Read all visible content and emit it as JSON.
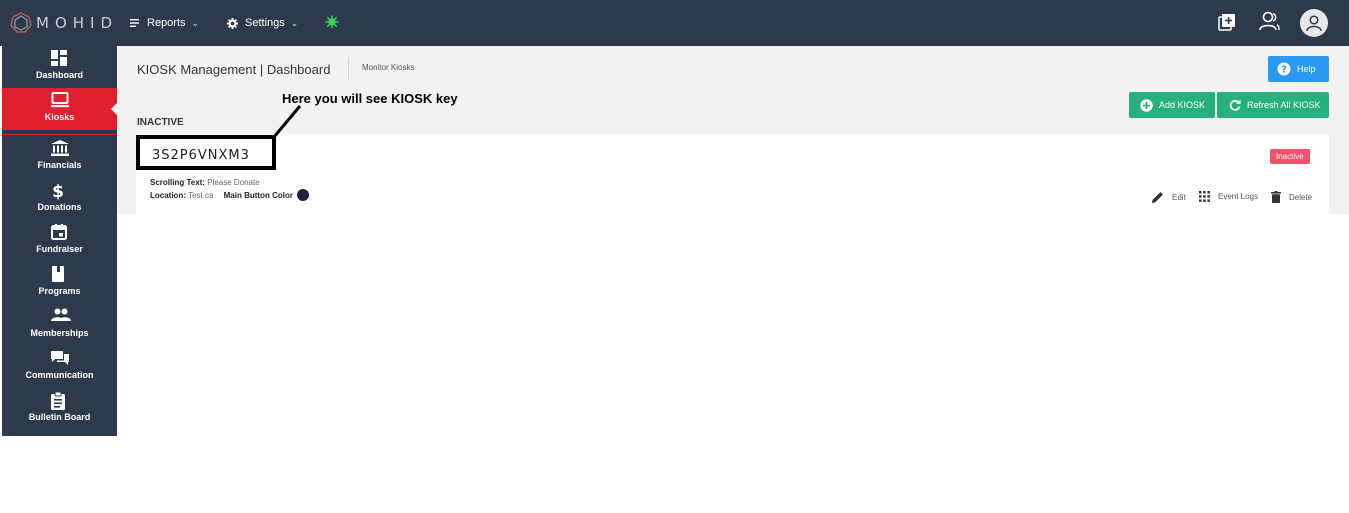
{
  "header": {
    "logo_text": "MOHID",
    "nav": [
      {
        "label": "Reports"
      },
      {
        "label": "Settings"
      }
    ],
    "colors": {
      "bar": "#2d3a4b",
      "accent_green": "#39d353"
    }
  },
  "sidebar": {
    "items": [
      {
        "label": "Dashboard",
        "icon": "dashboard-icon"
      },
      {
        "label": "Kiosks",
        "icon": "laptop-icon",
        "active": true
      },
      {
        "label": "Financials",
        "icon": "bank-icon"
      },
      {
        "label": "Donations",
        "icon": "dollar-icon"
      },
      {
        "label": "Fundraiser",
        "icon": "calendar-icon"
      },
      {
        "label": "Programs",
        "icon": "book-icon"
      },
      {
        "label": "Memberships",
        "icon": "people-icon"
      },
      {
        "label": "Communication",
        "icon": "chat-icon"
      },
      {
        "label": "Bulletin Board",
        "icon": "clipboard-icon"
      }
    ],
    "active_color": "#e0202e"
  },
  "page": {
    "title": "KIOSK Management | Dashboard",
    "breadcrumb": "Monitor Kiosks",
    "help_label": "Help",
    "add_label": "Add KIOSK",
    "refresh_label": "Refresh All KIOSK",
    "section_label": "INACTIVE"
  },
  "kiosk": {
    "key": "3S2P6VNXM3",
    "status": "Inactive",
    "scrolling_text_label": "Scrolling Text:",
    "scrolling_text_value": "Please Donate",
    "location_label": "Location:",
    "location_value": "Test ca",
    "main_button_color_label": "Main Button Color",
    "main_button_color": "#1b2344",
    "actions": {
      "edit": "Edit",
      "event_logs": "Event Logs",
      "delete": "Delete"
    }
  },
  "annotation": {
    "text": "Here you will see KIOSK key"
  }
}
